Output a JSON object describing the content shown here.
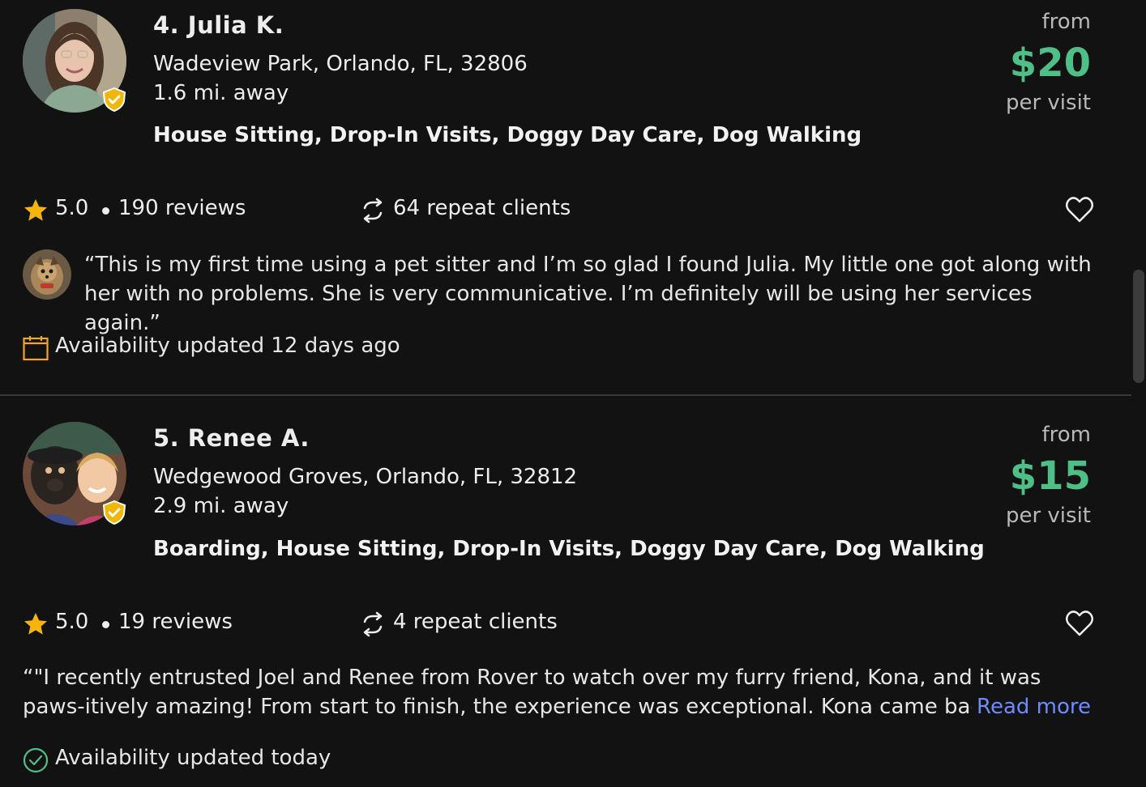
{
  "listings": [
    {
      "name": "4. Julia K.",
      "address": "Wadeview Park, Orlando, FL, 32806",
      "distance": "1.6 mi. away",
      "services": "House Sitting, Drop-In Visits, Doggy Day Care, Dog Walking",
      "price_from": "from",
      "price": "$20",
      "price_unit": "per visit",
      "rating": "5.0",
      "reviews": "190 reviews",
      "repeat_clients": "64 repeat clients",
      "review_text": "“This is my first time using a pet sitter and I’m so glad I found Julia. My little one got along with her with no problems. She is very communicative. I’m definitely will be using her services again.”",
      "availability": "Availability updated 12 days ago",
      "availability_icon": "calendar-icon"
    },
    {
      "name": "5. Renee A.",
      "address": "Wedgewood Groves, Orlando, FL, 32812",
      "distance": "2.9 mi. away",
      "services": "Boarding, House Sitting, Drop-In Visits, Doggy Day Care, Dog Walking",
      "price_from": "from",
      "price": "$15",
      "price_unit": "per visit",
      "rating": "5.0",
      "reviews": "19 reviews",
      "repeat_clients": "4 repeat clients",
      "review_text": "“\"I recently entrusted Joel and Renee from Rover to watch over my furry friend, Kona, and it was paws-itively amazing! From start to finish, the experience was exceptional. Kona came back home re",
      "read_more": "Read more",
      "availability": "Availability updated today",
      "availability_icon": "check-circle-icon"
    }
  ],
  "colors": {
    "background": "#121212",
    "price_green": "#4fbf88",
    "badge_gold": "#f2b705",
    "link_blue": "#6c8cff"
  }
}
